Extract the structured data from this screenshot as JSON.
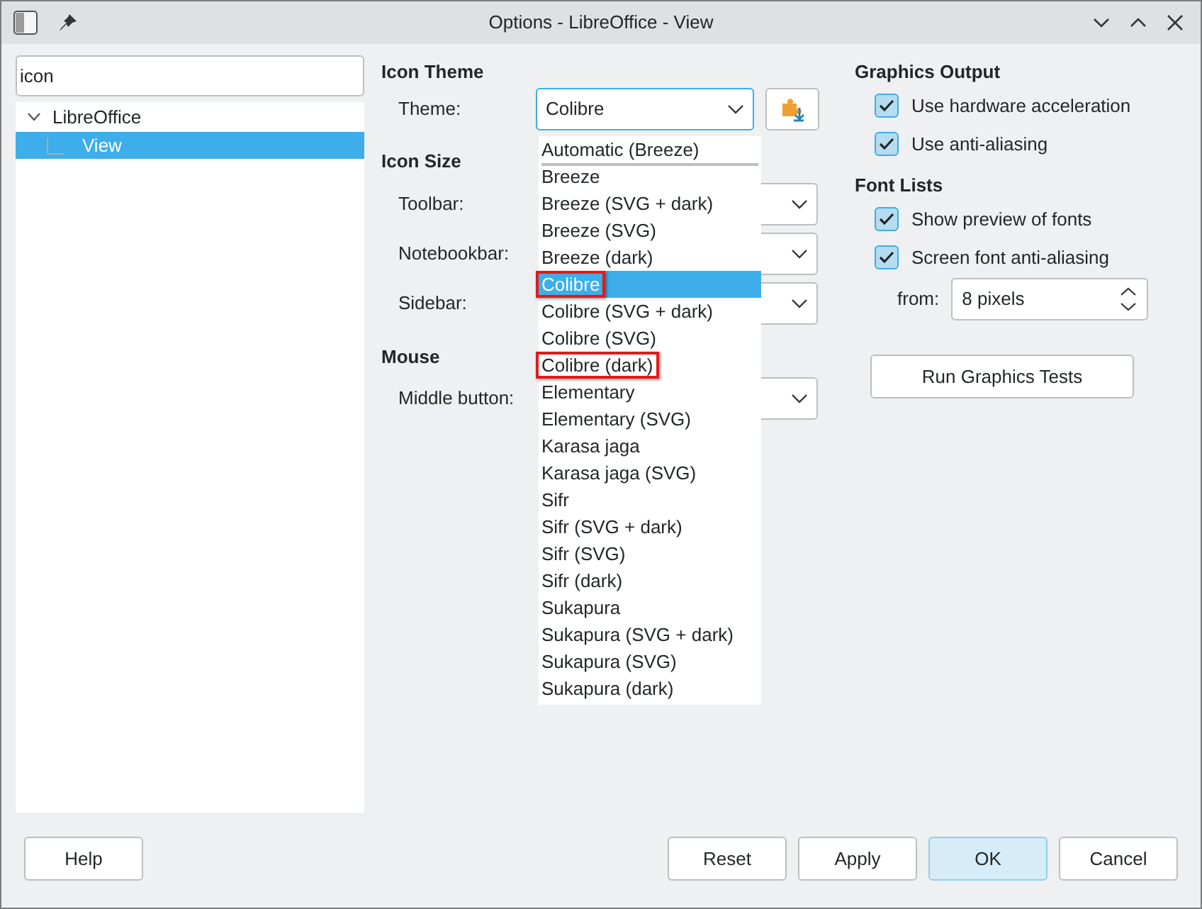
{
  "window": {
    "title": "Options - LibreOffice - View"
  },
  "search": {
    "value": "icon"
  },
  "tree": [
    {
      "label": "LibreOffice",
      "expanded": true,
      "selected": false,
      "children": [
        {
          "label": "View",
          "selected": true
        }
      ]
    }
  ],
  "icon_theme": {
    "heading": "Icon Theme",
    "theme": {
      "label": "Theme:",
      "value": "Colibre"
    },
    "options": [
      {
        "label": "Automatic (Breeze)",
        "kind": "automatic",
        "selected": false,
        "highlighted": false
      },
      {
        "label": "Breeze",
        "kind": "theme",
        "selected": false,
        "highlighted": false
      },
      {
        "label": "Breeze (SVG + dark)",
        "kind": "theme",
        "selected": false,
        "highlighted": false
      },
      {
        "label": "Breeze (SVG)",
        "kind": "theme",
        "selected": false,
        "highlighted": false
      },
      {
        "label": "Breeze (dark)",
        "kind": "theme",
        "selected": false,
        "highlighted": false
      },
      {
        "label": "Colibre",
        "kind": "theme",
        "selected": true,
        "highlighted": true
      },
      {
        "label": "Colibre (SVG + dark)",
        "kind": "theme",
        "selected": false,
        "highlighted": false
      },
      {
        "label": "Colibre (SVG)",
        "kind": "theme",
        "selected": false,
        "highlighted": false
      },
      {
        "label": "Colibre (dark)",
        "kind": "theme",
        "selected": false,
        "highlighted": true
      },
      {
        "label": "Elementary",
        "kind": "theme",
        "selected": false,
        "highlighted": false
      },
      {
        "label": "Elementary (SVG)",
        "kind": "theme",
        "selected": false,
        "highlighted": false
      },
      {
        "label": "Karasa jaga",
        "kind": "theme",
        "selected": false,
        "highlighted": false
      },
      {
        "label": "Karasa jaga (SVG)",
        "kind": "theme",
        "selected": false,
        "highlighted": false
      },
      {
        "label": "Sifr",
        "kind": "theme",
        "selected": false,
        "highlighted": false
      },
      {
        "label": "Sifr (SVG + dark)",
        "kind": "theme",
        "selected": false,
        "highlighted": false
      },
      {
        "label": "Sifr (SVG)",
        "kind": "theme",
        "selected": false,
        "highlighted": false
      },
      {
        "label": "Sifr (dark)",
        "kind": "theme",
        "selected": false,
        "highlighted": false
      },
      {
        "label": "Sukapura",
        "kind": "theme",
        "selected": false,
        "highlighted": false
      },
      {
        "label": "Sukapura (SVG + dark)",
        "kind": "theme",
        "selected": false,
        "highlighted": false
      },
      {
        "label": "Sukapura (SVG)",
        "kind": "theme",
        "selected": false,
        "highlighted": false
      },
      {
        "label": "Sukapura (dark)",
        "kind": "theme",
        "selected": false,
        "highlighted": false
      }
    ]
  },
  "icon_size": {
    "heading": "Icon Size",
    "fields": [
      {
        "label": "Toolbar:"
      },
      {
        "label": "Notebookbar:"
      },
      {
        "label": "Sidebar:"
      }
    ]
  },
  "mouse": {
    "heading": "Mouse",
    "fields": [
      {
        "label": "Middle button:"
      }
    ]
  },
  "graphics_output": {
    "heading": "Graphics Output",
    "checkboxes": [
      {
        "label": "Use hardware acceleration",
        "checked": true
      },
      {
        "label": "Use anti-aliasing",
        "checked": true
      }
    ]
  },
  "font_lists": {
    "heading": "Font Lists",
    "checkboxes": [
      {
        "label": "Show preview of fonts",
        "checked": true
      },
      {
        "label": "Screen font anti-aliasing",
        "checked": true
      }
    ],
    "from": {
      "label": "from:",
      "value": "8 pixels"
    }
  },
  "run_tests_button": "Run Graphics Tests",
  "buttons": [
    {
      "label": "Help",
      "default": false
    },
    {
      "label": "Reset",
      "default": false
    },
    {
      "label": "Apply",
      "default": false
    },
    {
      "label": "OK",
      "default": true
    },
    {
      "label": "Cancel",
      "default": false
    }
  ]
}
